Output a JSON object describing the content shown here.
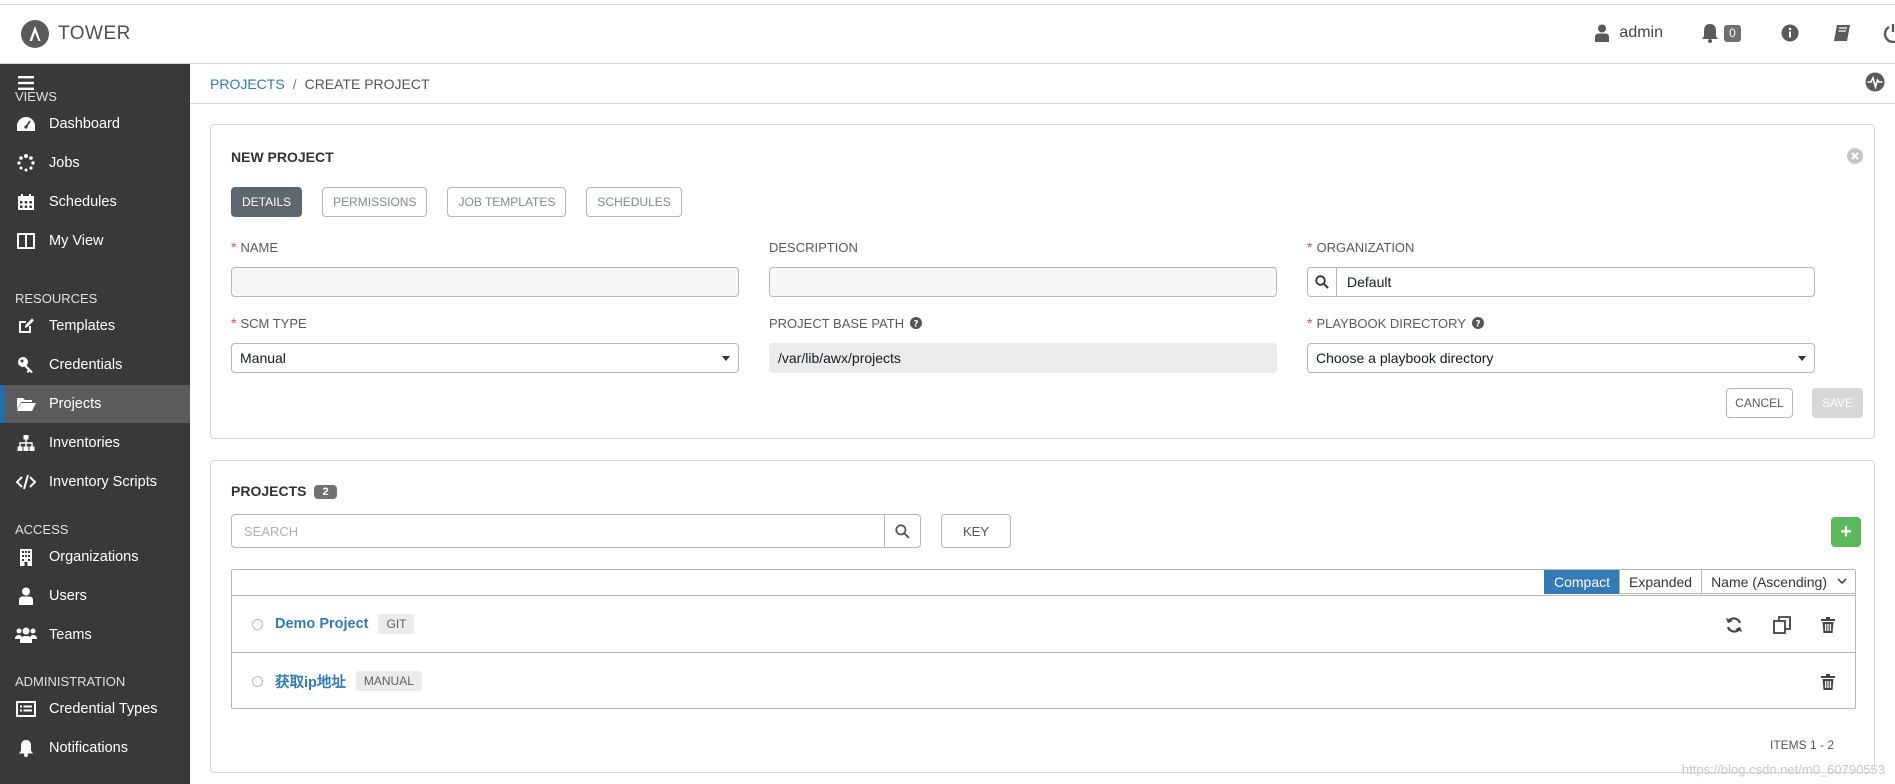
{
  "app": {
    "brand": "TOWER"
  },
  "topbar": {
    "user": "admin",
    "notifications": "0"
  },
  "sidebar": {
    "sections": [
      {
        "header": "VIEWS",
        "items": [
          {
            "label": "Dashboard",
            "icon": "dashboard-icon"
          },
          {
            "label": "Jobs",
            "icon": "spinner-icon"
          },
          {
            "label": "Schedules",
            "icon": "calendar-icon"
          },
          {
            "label": "My View",
            "icon": "columns-icon"
          }
        ]
      },
      {
        "header": "RESOURCES",
        "items": [
          {
            "label": "Templates",
            "icon": "pencil-square-icon"
          },
          {
            "label": "Credentials",
            "icon": "key-icon"
          },
          {
            "label": "Projects",
            "icon": "folder-open-icon",
            "active": true
          },
          {
            "label": "Inventories",
            "icon": "sitemap-icon"
          },
          {
            "label": "Inventory Scripts",
            "icon": "code-icon"
          }
        ]
      },
      {
        "header": "ACCESS",
        "items": [
          {
            "label": "Organizations",
            "icon": "building-icon"
          },
          {
            "label": "Users",
            "icon": "user-icon"
          },
          {
            "label": "Teams",
            "icon": "users-icon"
          }
        ]
      },
      {
        "header": "ADMINISTRATION",
        "items": [
          {
            "label": "Credential Types",
            "icon": "list-alt-icon"
          },
          {
            "label": "Notifications",
            "icon": "bell-icon"
          }
        ]
      }
    ]
  },
  "breadcrumb": {
    "parent": "PROJECTS",
    "separator": "/",
    "current": "CREATE PROJECT"
  },
  "form": {
    "title": "NEW PROJECT",
    "tabs": [
      "DETAILS",
      "PERMISSIONS",
      "JOB TEMPLATES",
      "SCHEDULES"
    ],
    "fields": {
      "name": {
        "label": "NAME",
        "value": ""
      },
      "description": {
        "label": "DESCRIPTION",
        "value": ""
      },
      "organization": {
        "label": "ORGANIZATION",
        "value": "Default"
      },
      "scm_type": {
        "label": "SCM TYPE",
        "value": "Manual"
      },
      "base_path": {
        "label": "PROJECT BASE PATH",
        "value": "/var/lib/awx/projects"
      },
      "playbook_dir": {
        "label": "PLAYBOOK DIRECTORY",
        "value": "Choose a playbook directory"
      }
    },
    "cancel_label": "CANCEL",
    "save_label": "SAVE"
  },
  "list": {
    "title": "PROJECTS",
    "count": "2",
    "search_placeholder": "SEARCH",
    "key_label": "KEY",
    "add_label": "+",
    "view_compact": "Compact",
    "view_expanded": "Expanded",
    "sort_label": "Name (Ascending)",
    "rows": [
      {
        "name": "Demo Project",
        "scm": "GIT"
      },
      {
        "name": "获取ip地址",
        "scm": "MANUAL"
      }
    ],
    "items_label": "ITEMS  1 - 2"
  },
  "watermark": "https://blog.csdn.net/m0_60790553"
}
